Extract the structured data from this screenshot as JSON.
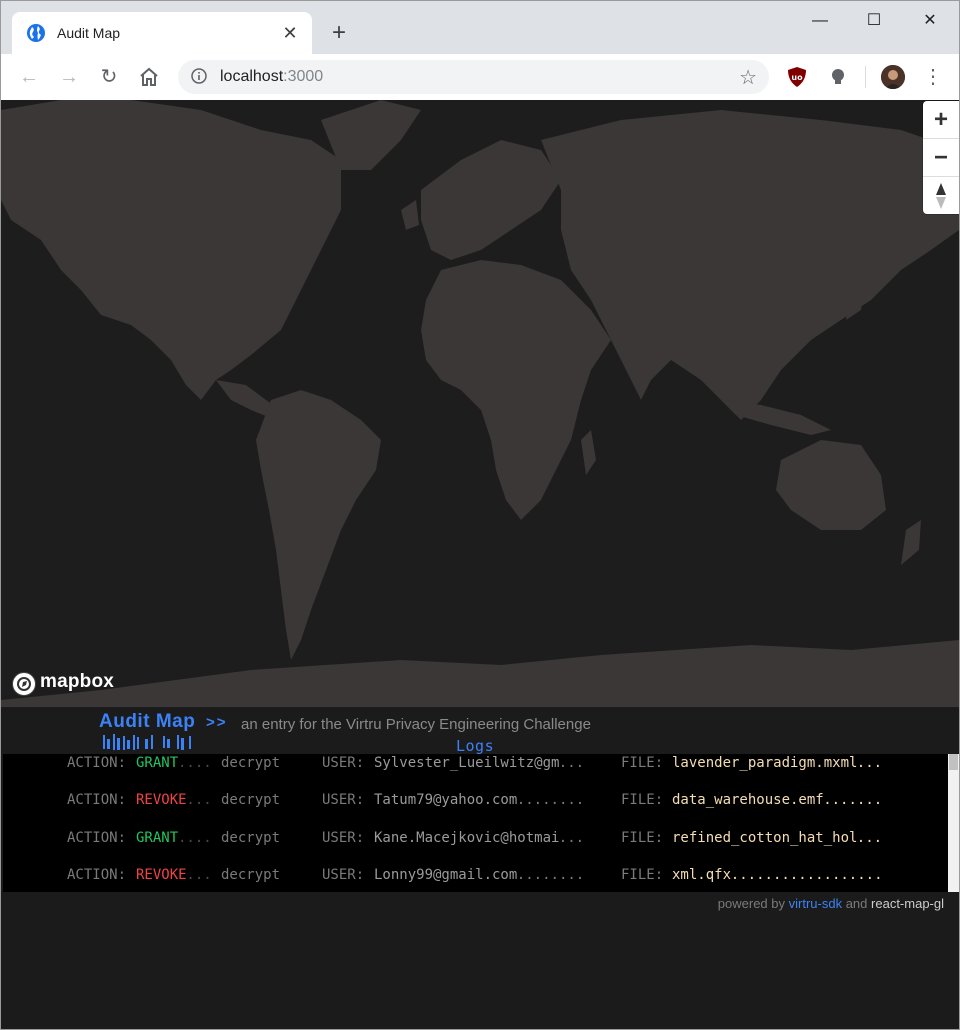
{
  "browser": {
    "tab_title": "Audit Map",
    "new_tab_icon": "+",
    "url_host": "localhost",
    "url_port": ":3000",
    "window_controls": [
      "minimize",
      "maximize",
      "close"
    ]
  },
  "map": {
    "attribution_logo": "mapbox",
    "zoom_in": "+",
    "zoom_out": "−",
    "compass": "▲▼"
  },
  "header": {
    "brand": "Audit Map",
    "arrows": ">>",
    "tagline": "an entry for the Virtru Privacy Engineering Challenge",
    "logs_label": "Logs_"
  },
  "logs": {
    "action_key": "ACTION:",
    "user_key": "USER:",
    "file_key": "FILE:",
    "rows": [
      {
        "action": "GRANT",
        "action_pad": "....",
        "op": "decrypt",
        "user": "Sylvester_Lueilwitz@gm",
        "user_pad": "...",
        "file": "lavender_paradigm.mxml",
        "file_pad": "..."
      },
      {
        "action": "REVOKE",
        "action_pad": "...",
        "op": "decrypt",
        "user": "Tatum79@yahoo.com",
        "user_pad": "........",
        "file": "data_warehouse.emf",
        "file_pad": "......."
      },
      {
        "action": "GRANT",
        "action_pad": "....",
        "op": "decrypt",
        "user": "Kane.Macejkovic@hotmai",
        "user_pad": "...",
        "file": "refined_cotton_hat_hol",
        "file_pad": "..."
      },
      {
        "action": "REVOKE",
        "action_pad": "...",
        "op": "decrypt",
        "user": "Lonny99@gmail.com",
        "user_pad": "........",
        "file": "xml.qfx",
        "file_pad": ".................."
      }
    ]
  },
  "footer": {
    "powered_by": "powered by",
    "sdk_link": "virtru-sdk",
    "and": "and",
    "lib_link": "react-map-gl"
  },
  "colors": {
    "accent": "#3b82f6",
    "grant": "#22c55e",
    "revoke": "#ef4444",
    "file_text": "#f5deb3",
    "land": "#3a3736",
    "water": "#1d1d1d"
  }
}
